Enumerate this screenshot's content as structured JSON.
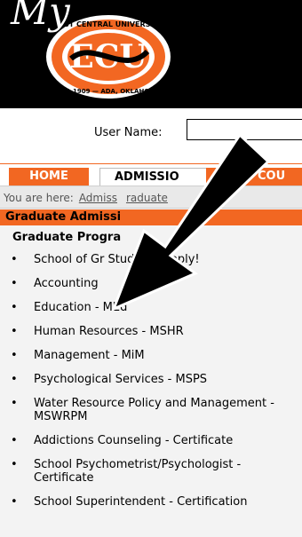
{
  "header": {
    "logo_wordmark": "My",
    "seal_top_text": "EAST CENTRAL UNIVERSITY",
    "seal_center_text": "ECU",
    "seal_bottom_text": "EST. 1909 — ADA, OKLAHOMA",
    "brand_color": "#f26722"
  },
  "login": {
    "username_label": "User Name:",
    "username_value": ""
  },
  "nav": {
    "tabs": [
      {
        "label": "HOME"
      },
      {
        "label": "ADMISSIO"
      },
      {
        "label": "COU"
      }
    ]
  },
  "breadcrumb": {
    "prefix": "You are here:",
    "link1": "Admiss",
    "link2": "raduate"
  },
  "main": {
    "section_title": "Graduate Admissi",
    "subsection_title": "Graduate Progra",
    "programs": [
      "School of Gr       Studies - Apply!",
      "Accounting",
      "Education - MEd",
      "Human Resources - MSHR",
      "Management - MiM",
      "Psychological Services - MSPS",
      "Water Resource Policy and Management - MSWRPM",
      "Addictions Counseling - Certificate",
      "School Psychometrist/Psychologist - Certificate",
      "School Superintendent - Certification"
    ]
  },
  "overlay": {
    "arrow_icon": "big-black-arrow-icon",
    "arrow_color": "#000000"
  }
}
